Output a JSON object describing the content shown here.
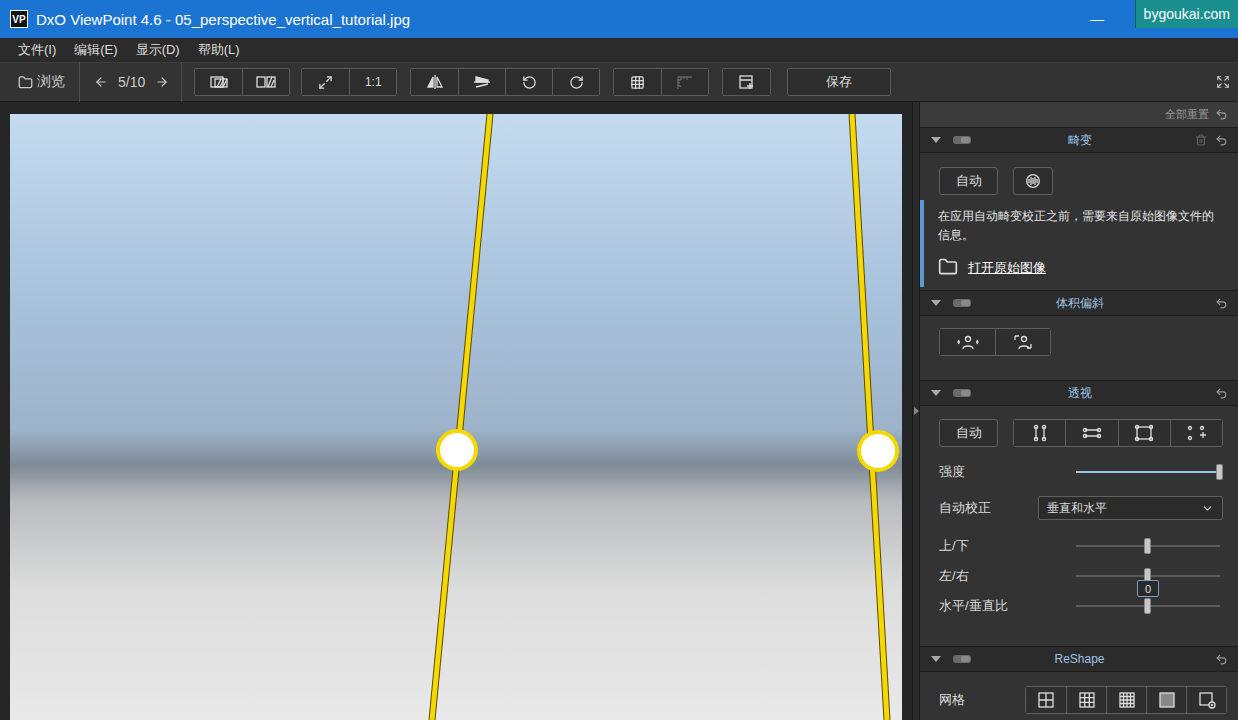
{
  "window": {
    "title": "DxO ViewPoint 4.6 - 05_perspective_vertical_tutorial.jpg",
    "logo": "VP",
    "minimize": "—"
  },
  "watermark": "bygoukai.com",
  "menu": [
    "文件(I)",
    "编辑(E)",
    "显示(D)",
    "帮助(L)"
  ],
  "toolbar": {
    "browse": "浏览",
    "counter": "5/10",
    "groups": [
      [
        {
          "kind": "compare",
          "disabled": false
        },
        {
          "kind": "split",
          "disabled": false
        }
      ],
      [
        {
          "kind": "fit",
          "disabled": false
        },
        {
          "kind": "zoom",
          "label": "1:1",
          "disabled": false
        }
      ],
      [
        {
          "kind": "mirror",
          "disabled": false
        },
        {
          "kind": "flip",
          "disabled": false
        },
        {
          "kind": "rotleft",
          "disabled": false
        },
        {
          "kind": "rotright",
          "disabled": false
        }
      ],
      [
        {
          "kind": "grid",
          "disabled": false
        },
        {
          "kind": "ruler",
          "disabled": true
        }
      ],
      [
        {
          "kind": "panel",
          "disabled": false
        }
      ]
    ],
    "save": "保存"
  },
  "panel": {
    "reset_all": "全部重置",
    "distortion": {
      "title": "畸变",
      "expanded": true,
      "auto": "自动",
      "notice": "在应用自动畸变校正之前，需要来自原始图像文件的信息。",
      "open_original": "打开原始图像"
    },
    "volume": {
      "title": "体积偏斜",
      "expanded": true,
      "tools": [
        {
          "kind": "spherical",
          "selected": false
        },
        {
          "kind": "cylindrical",
          "selected": false
        }
      ]
    },
    "perspective": {
      "title": "透视",
      "expanded": true,
      "auto": "自动",
      "tools": [
        {
          "kind": "vertical",
          "selected": false
        },
        {
          "kind": "horizontal",
          "selected": false
        },
        {
          "kind": "rectangle",
          "selected": false
        },
        {
          "kind": "eightpoint",
          "selected": false
        }
      ],
      "rows": [
        {
          "kind": "slider",
          "label": "强度",
          "level": 1
        },
        {
          "kind": "select",
          "label": "自动校正",
          "value": "垂直和水平"
        },
        {
          "kind": "bipolar",
          "label": "上/下",
          "level": 0.5
        },
        {
          "kind": "bipolar",
          "label": "左/右",
          "level": 0.5,
          "reading": "0"
        },
        {
          "kind": "bipolar",
          "label": "水平/垂直比",
          "level": 0.5
        }
      ]
    },
    "reshape": {
      "title": "ReShape",
      "expanded": true,
      "grid_label": "网格",
      "grid_options": [
        {
          "kind": "g2",
          "selected": false
        },
        {
          "kind": "g3",
          "selected": false
        },
        {
          "kind": "g4",
          "selected": false
        },
        {
          "kind": "solid",
          "selected": false
        },
        {
          "kind": "custom",
          "selected": false
        }
      ]
    }
  }
}
